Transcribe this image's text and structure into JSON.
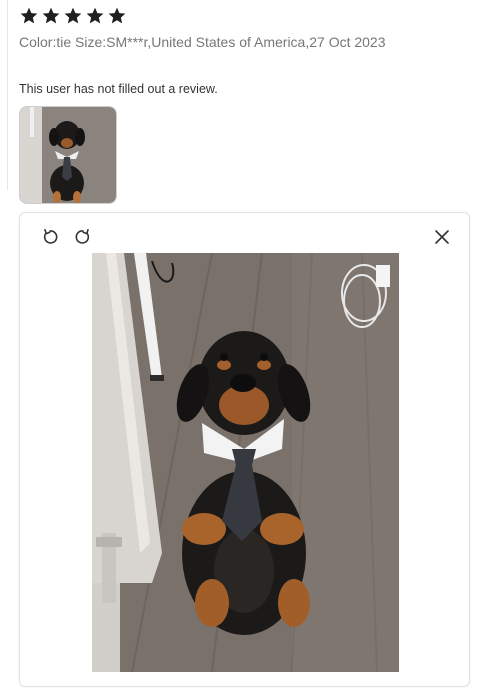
{
  "rating": {
    "stars": 5,
    "max": 5,
    "color": "#1f1f1f"
  },
  "meta_line": "Color:tie Size:SM***r,United States of America,27 Oct 2023",
  "review_text": "This user has not filled out a review.",
  "thumbnail": {
    "alt": "dachshund wearing a collar and tie"
  },
  "viewer": {
    "controls": [
      "rotate-left-icon",
      "rotate-right-icon",
      "close-icon"
    ],
    "image_alt": "dachshund wearing a collar and tie"
  }
}
